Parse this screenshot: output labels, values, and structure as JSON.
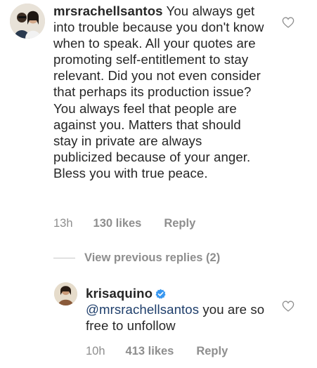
{
  "comment": {
    "username": "mrsrachellsantos",
    "text": "You always get into trouble because you don't know when to speak. All your quotes are promoting self-entitlement to stay relevant. Did you not even consider that perhaps its production issue? You always feel that people are against you. Matters that should stay in private are always publicized because of your anger. Bless you with true peace.",
    "time": "13h",
    "likes": "130 likes",
    "reply_label": "Reply",
    "avatar_icon": "profile-photo-couple"
  },
  "replies_toggle": {
    "label": "View previous replies (2)"
  },
  "reply": {
    "username": "krisaquino",
    "verified_icon": "verified-badge-icon",
    "verified_color": "#3897f0",
    "mention": "@mrsrachellsantos",
    "text": "you are so free to unfollow",
    "time": "10h",
    "likes": "413 likes",
    "reply_label": "Reply",
    "avatar_icon": "profile-photo-person"
  },
  "heart_icon": "heart-outline-icon"
}
